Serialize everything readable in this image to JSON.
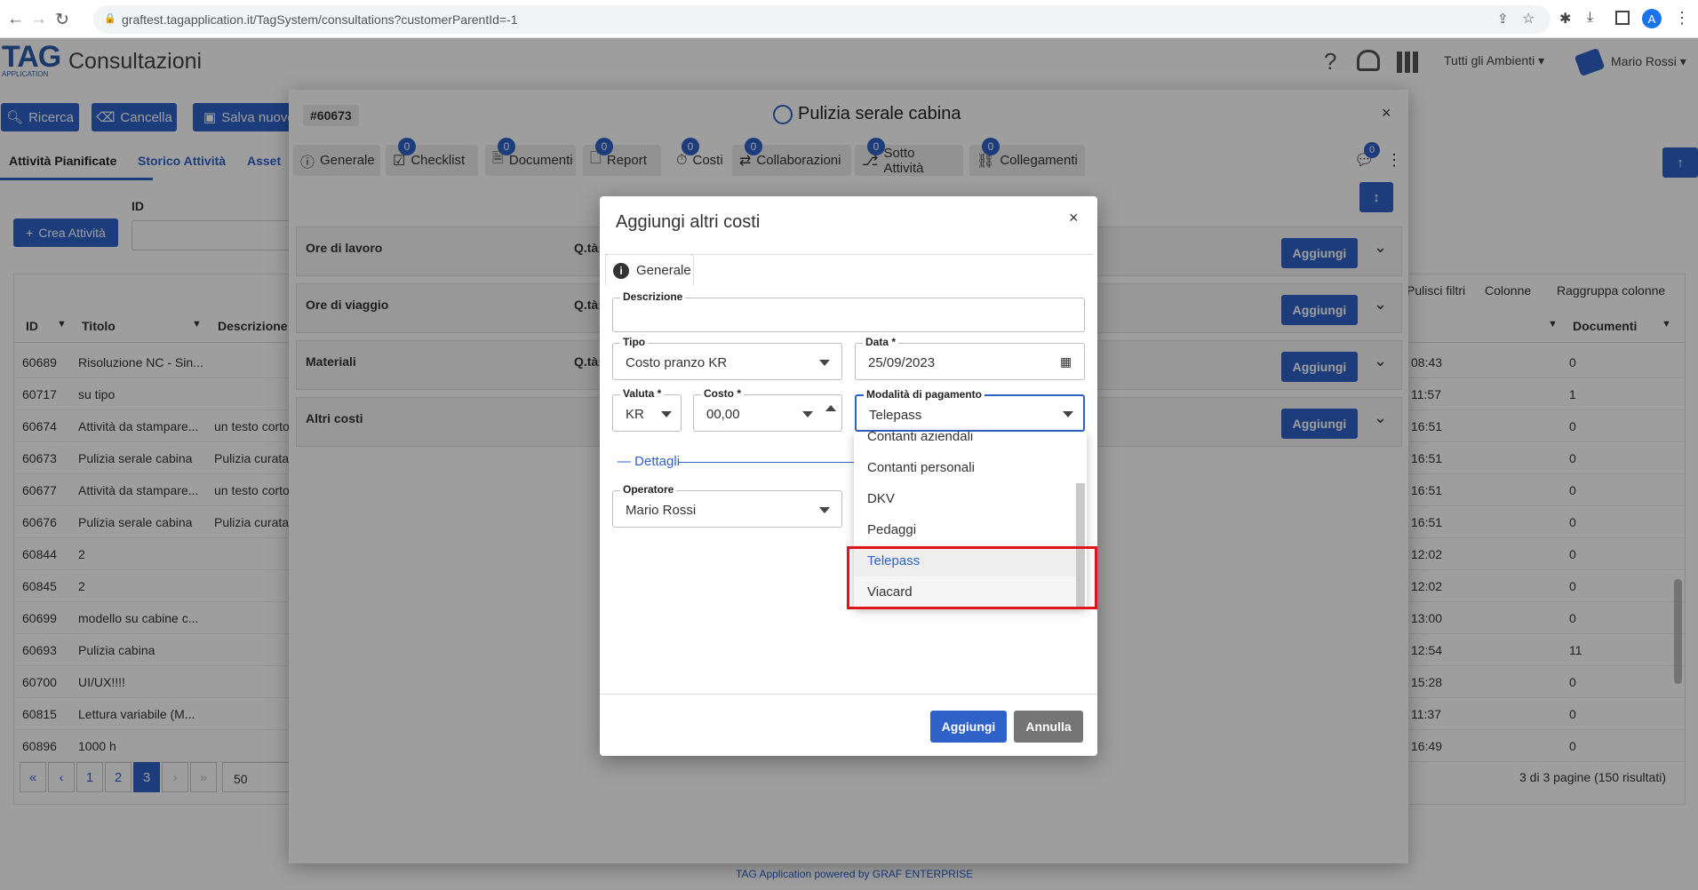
{
  "browser": {
    "url": "graftest.tagapplication.it/TagSystem/consultations?customerParentId=-1"
  },
  "app": {
    "logo": "TAG",
    "logo_sub": "APPLICATION",
    "title": "Consultazioni",
    "env": "Tutti gli Ambienti",
    "user": "Mario Rossi",
    "footer": "TAG Application powered by GRAF ENTERPRISE"
  },
  "toolbar": {
    "search": "Ricerca",
    "clear": "Cancella",
    "save_new": "Salva nuovo"
  },
  "main_tabs": [
    "Attività Pianificate",
    "Storico Attività",
    "Asset"
  ],
  "create_button": "Crea Attività",
  "filter_label": "ID",
  "grid": {
    "actions": [
      "Pulisci filtri",
      "Colonne",
      "Raggruppa colonne"
    ],
    "headers": {
      "id": "ID",
      "title": "Titolo",
      "desc": "Descrizione",
      "docs": "Documenti"
    },
    "rows": [
      {
        "id": "60689",
        "title": "Risoluzione NC - Sin...",
        "desc": "",
        "time": "08:43",
        "docs": "0"
      },
      {
        "id": "60717",
        "title": "su tipo",
        "desc": "",
        "time": "11:57",
        "docs": "1"
      },
      {
        "id": "60674",
        "title": "Attività da stampare...",
        "desc": "un testo corto",
        "time": "16:51",
        "docs": "0"
      },
      {
        "id": "60673",
        "title": "Pulizia serale cabina",
        "desc": "Pulizia curata",
        "time": "16:51",
        "docs": "0"
      },
      {
        "id": "60677",
        "title": "Attività da stampare...",
        "desc": "un testo corto",
        "time": "16:51",
        "docs": "0"
      },
      {
        "id": "60676",
        "title": "Pulizia serale cabina",
        "desc": "Pulizia curata",
        "time": "16:51",
        "docs": "0"
      },
      {
        "id": "60844",
        "title": "2",
        "desc": "",
        "time": "12:02",
        "docs": "0"
      },
      {
        "id": "60845",
        "title": "2",
        "desc": "",
        "time": "12:02",
        "docs": "0"
      },
      {
        "id": "60699",
        "title": "modello su cabine c...",
        "desc": "",
        "time": "13:00",
        "docs": "0"
      },
      {
        "id": "60693",
        "title": "Pulizia cabina",
        "desc": "",
        "time": "12:54",
        "docs": "11"
      },
      {
        "id": "60700",
        "title": "UI/UX!!!!",
        "desc": "",
        "time": "15:28",
        "docs": "0"
      },
      {
        "id": "60815",
        "title": "Lettura variabile (M...",
        "desc": "",
        "time": "11:37",
        "docs": "0"
      },
      {
        "id": "60896",
        "title": "1000 h",
        "desc": "",
        "time": "16:49",
        "docs": "0"
      }
    ],
    "pages": [
      "1",
      "2",
      "3"
    ],
    "page_size": "50",
    "summary": "3 di 3 pagine (150 risultati)"
  },
  "activity": {
    "id": "#60673",
    "title": "Pulizia serale cabina",
    "tabs": [
      {
        "label": "Generale",
        "badge": ""
      },
      {
        "label": "Checklist",
        "badge": "0"
      },
      {
        "label": "Documenti",
        "badge": "0"
      },
      {
        "label": "Report",
        "badge": "0"
      },
      {
        "label": "Costi",
        "badge": "0"
      },
      {
        "label": "Collaborazioni",
        "badge": "0"
      },
      {
        "label": "Sotto Attività",
        "badge": "0"
      },
      {
        "label": "Collegamenti",
        "badge": "0"
      }
    ],
    "chat_badge": "0",
    "sections": [
      {
        "label": "Ore di lavoro",
        "qty": "Q.tà:",
        "add": "Aggiungi"
      },
      {
        "label": "Ore di viaggio",
        "qty": "Q.tà:",
        "add": "Aggiungi"
      },
      {
        "label": "Materiali",
        "qty": "Q.tà:",
        "add": "Aggiungi"
      },
      {
        "label": "Altri costi",
        "qty": "",
        "add": "Aggiungi"
      }
    ]
  },
  "dialog": {
    "title": "Aggiungi altri costi",
    "tab": "Generale",
    "fields": {
      "descrizione": {
        "label": "Descrizione",
        "value": ""
      },
      "tipo": {
        "label": "Tipo",
        "value": "Costo pranzo KR"
      },
      "data": {
        "label": "Data *",
        "value": "25/09/2023"
      },
      "valuta": {
        "label": "Valuta *",
        "value": "KR"
      },
      "costo": {
        "label": "Costo *",
        "value": "00,00"
      },
      "modalita": {
        "label": "Modalità di pagamento",
        "value": "Telepass"
      },
      "operatore": {
        "label": "Operatore",
        "value": "Mario Rossi"
      }
    },
    "details_label": "— Dettagli",
    "dropdown_options": [
      "Contanti aziendali",
      "Contanti personali",
      "DKV",
      "Pedaggi",
      "Telepass",
      "Viacard"
    ],
    "selected_option": "Telepass",
    "confirm": "Aggiungi",
    "cancel": "Annulla"
  },
  "colors": {
    "primary": "#2e62c9",
    "highlight": "#e0141b",
    "selected_text": "#2e62c9"
  }
}
